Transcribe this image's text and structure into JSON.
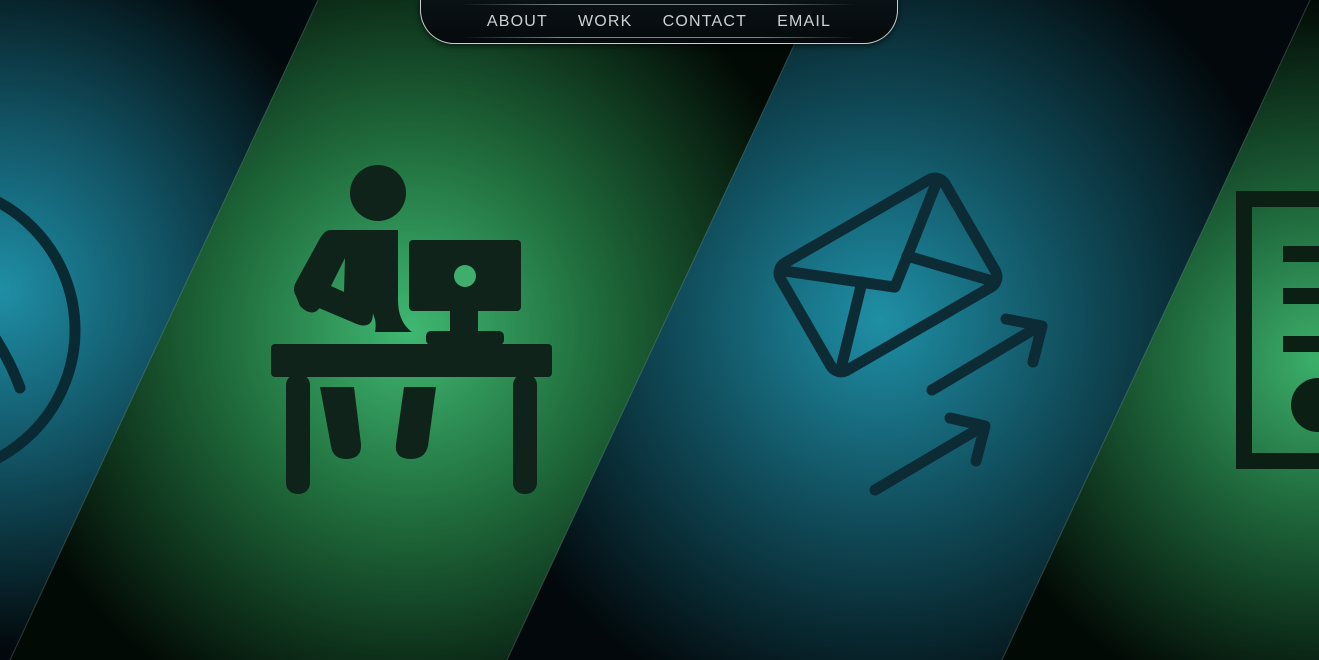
{
  "nav": {
    "items": [
      {
        "label": "ABOUT"
      },
      {
        "label": "WORK"
      },
      {
        "label": "CONTACT"
      },
      {
        "label": "EMAIL"
      }
    ]
  },
  "panels": [
    {
      "section": "about",
      "icon": "person-circle-icon",
      "color": "#1e8aa0"
    },
    {
      "section": "work",
      "icon": "person-at-computer-desk-icon",
      "color": "#3fb572"
    },
    {
      "section": "contact",
      "icon": "envelope-send-icon",
      "color": "#1e8aa0"
    },
    {
      "section": "email",
      "icon": "document-icon",
      "color": "#3fb572"
    }
  ],
  "colors": {
    "teal_glow": "#1f8fa6",
    "green_glow": "#3cb06b",
    "icon_dark": "#0e1f1a",
    "icon_dark_teal": "#0b2a33",
    "nav_text": "#c9d2cf",
    "nav_border": "#dce6e1"
  }
}
